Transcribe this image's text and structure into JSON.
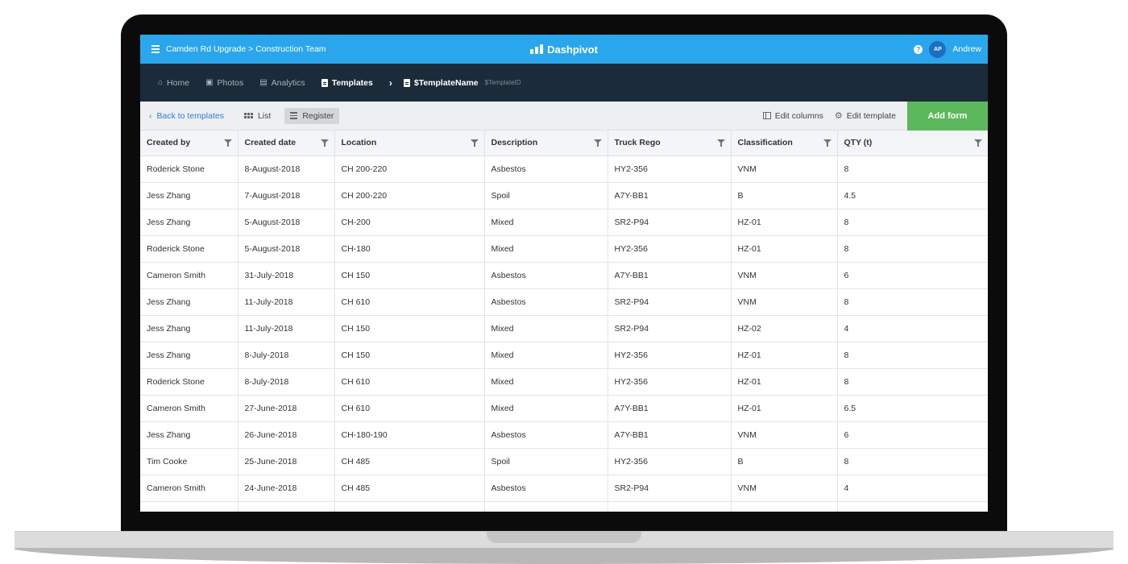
{
  "header": {
    "project": "Camden Rd Upgrade > Construction Team",
    "brand": "Dashpivot",
    "user_initials": "AP",
    "user_name": "Andrew",
    "help_icon": "?"
  },
  "nav": {
    "home": "Home",
    "photos": "Photos",
    "analytics": "Analytics",
    "templates": "Templates",
    "template_name": "$TemplateName",
    "template_id": "$TemplateID"
  },
  "toolbar": {
    "back": "Back to templates",
    "list": "List",
    "register": "Register",
    "edit_columns": "Edit columns",
    "edit_template": "Edit template",
    "add_form": "Add form"
  },
  "table": {
    "columns": [
      "Created by",
      "Created date",
      "Location",
      "Description",
      "Truck Rego",
      "Classification",
      "QTY (t)"
    ],
    "rows": [
      [
        "Roderick Stone",
        "8-August-2018",
        "CH 200-220",
        "Asbestos",
        "HY2-356",
        "VNM",
        "8"
      ],
      [
        "Jess Zhang",
        "7-August-2018",
        "CH 200-220",
        "Spoil",
        "A7Y-BB1",
        "B",
        "4.5"
      ],
      [
        "Jess Zhang",
        "5-August-2018",
        "CH-200",
        "Mixed",
        "SR2-P94",
        "HZ-01",
        "8"
      ],
      [
        "Roderick Stone",
        "5-August-2018",
        "CH-180",
        "Mixed",
        "HY2-356",
        "HZ-01",
        "8"
      ],
      [
        "Cameron Smith",
        "31-July-2018",
        "CH 150",
        "Asbestos",
        "A7Y-BB1",
        "VNM",
        "6"
      ],
      [
        "Jess Zhang",
        "11-July-2018",
        "CH 610",
        "Asbestos",
        "SR2-P94",
        "VNM",
        "8"
      ],
      [
        "Jess Zhang",
        "11-July-2018",
        "CH 150",
        "Mixed",
        "SR2-P94",
        "HZ-02",
        "4"
      ],
      [
        "Jess Zhang",
        "8-July-2018",
        "CH 150",
        "Mixed",
        "HY2-356",
        "HZ-01",
        "8"
      ],
      [
        "Roderick Stone",
        "8-July-2018",
        "CH 610",
        "Mixed",
        "HY2-356",
        "HZ-01",
        "8"
      ],
      [
        "Cameron Smith",
        "27-June-2018",
        "CH 610",
        "Mixed",
        "A7Y-BB1",
        "HZ-01",
        "6.5"
      ],
      [
        "Jess Zhang",
        "26-June-2018",
        "CH-180-190",
        "Asbestos",
        "A7Y-BB1",
        "VNM",
        "6"
      ],
      [
        "Tim Cooke",
        "25-June-2018",
        "CH 485",
        "Spoil",
        "HY2-356",
        "B",
        "8"
      ],
      [
        "Cameron Smith",
        "24-June-2018",
        "CH 485",
        "Asbestos",
        "SR2-P94",
        "VNM",
        "4"
      ],
      [
        "",
        "",
        "",
        "",
        "",
        "",
        ""
      ]
    ]
  },
  "colors": {
    "topbar": "#2aa6ec",
    "navbar": "#1c2b39",
    "add_form": "#5cb85c",
    "link": "#2a7fd4"
  }
}
